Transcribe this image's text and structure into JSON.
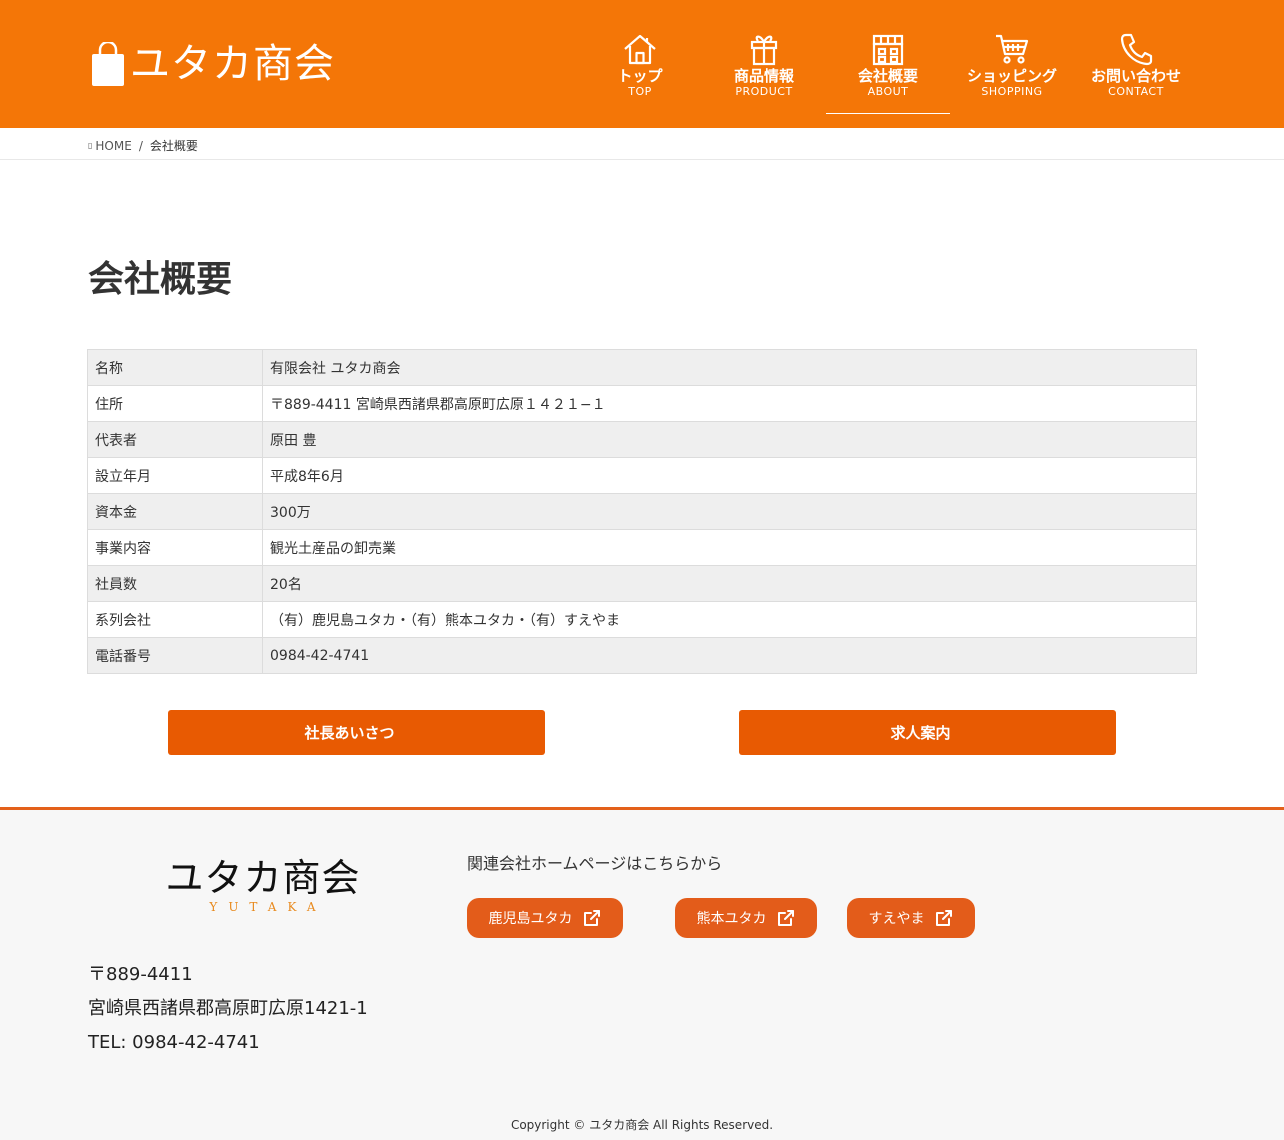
{
  "header": {
    "logo_text": "ユタカ商会",
    "nav": [
      {
        "jp": "トップ",
        "en": "TOP",
        "icon": "home-icon"
      },
      {
        "jp": "商品情報",
        "en": "PRODUCT",
        "icon": "gift-icon"
      },
      {
        "jp": "会社概要",
        "en": "ABOUT",
        "icon": "building-icon",
        "active": true
      },
      {
        "jp": "ショッピング",
        "en": "SHOPPING",
        "icon": "cart-icon"
      },
      {
        "jp": "お問い合わせ",
        "en": "CONTACT",
        "icon": "phone-icon"
      }
    ],
    "colors": {
      "brand": "#f47607",
      "button": "#e85a02",
      "footer_accent": "#e3601a"
    }
  },
  "breadcrumb": {
    "home": "HOME",
    "separator": "/",
    "current": "会社概要"
  },
  "page_title": "会社概要",
  "company_table": [
    {
      "label": "名称",
      "value": "有限会社 ユタカ商会"
    },
    {
      "label": "住所",
      "value": "〒889-4411 宮崎県西諸県郡高原町広原１４２１−１"
    },
    {
      "label": "代表者",
      "value": "原田 豊"
    },
    {
      "label": "設立年月",
      "value": "平成8年6月"
    },
    {
      "label": "資本金",
      "value": "300万"
    },
    {
      "label": "事業内容",
      "value": "観光土産品の卸売業"
    },
    {
      "label": "社員数",
      "value": "20名"
    },
    {
      "label": "系列会社",
      "value": "（有）鹿児島ユタカ・（有）熊本ユタカ・（有）すえやま"
    },
    {
      "label": "電話番号",
      "value": "0984-42-4741"
    }
  ],
  "buttons": {
    "greeting": "社長あいさつ",
    "recruit": "求人案内",
    "chevron": ""
  },
  "footer": {
    "logo_jp": "ユタカ商会",
    "logo_en": "YUTAKA",
    "postal": "〒889-4411",
    "address": "宮崎県西諸県郡高原町広原1421-1",
    "tel": "TEL: 0984-42-4741",
    "related_title": "関連会社ホームページはこちらから",
    "related_links": [
      "鹿児島ユタカ",
      "熊本ユタカ",
      "すえやま"
    ],
    "copyright": "Copyright © ユタカ商会 All Rights Reserved."
  }
}
